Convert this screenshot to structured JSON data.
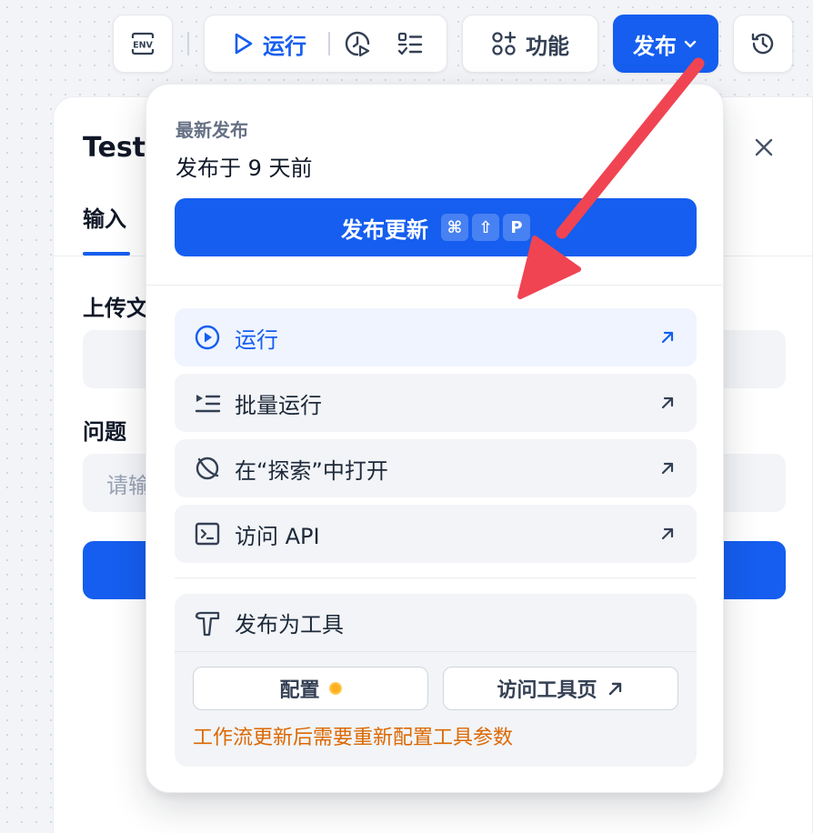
{
  "toolbar": {
    "env_label": "ENV",
    "run_label": "运行",
    "feature_label": "功能",
    "publish_label": "发布"
  },
  "test_panel": {
    "title": "Test",
    "tab_input": "输入",
    "upload_label": "上传文",
    "question_label": "问题",
    "question_placeholder": "请输"
  },
  "publish_menu": {
    "latest_label": "最新发布",
    "published_ago": "发布于 9 天前",
    "publish_update_label": "发布更新",
    "shortcut_keys": [
      "⌘",
      "⇧",
      "P"
    ],
    "items": [
      {
        "label": "运行",
        "icon": "play-circle-icon",
        "active": true
      },
      {
        "label": "批量运行",
        "icon": "batch-run-icon",
        "active": false
      },
      {
        "label": "在“探索”中打开",
        "icon": "explore-icon",
        "active": false
      },
      {
        "label": "访问 API",
        "icon": "terminal-icon",
        "active": false
      }
    ],
    "tool": {
      "label": "发布为工具",
      "config_label": "配置",
      "visit_tool_label": "访问工具页",
      "warning": "工作流更新后需要重新配置工具参数"
    }
  },
  "colors": {
    "primary": "#155eef",
    "warning": "#dc6803",
    "annotation": "#f04452"
  }
}
